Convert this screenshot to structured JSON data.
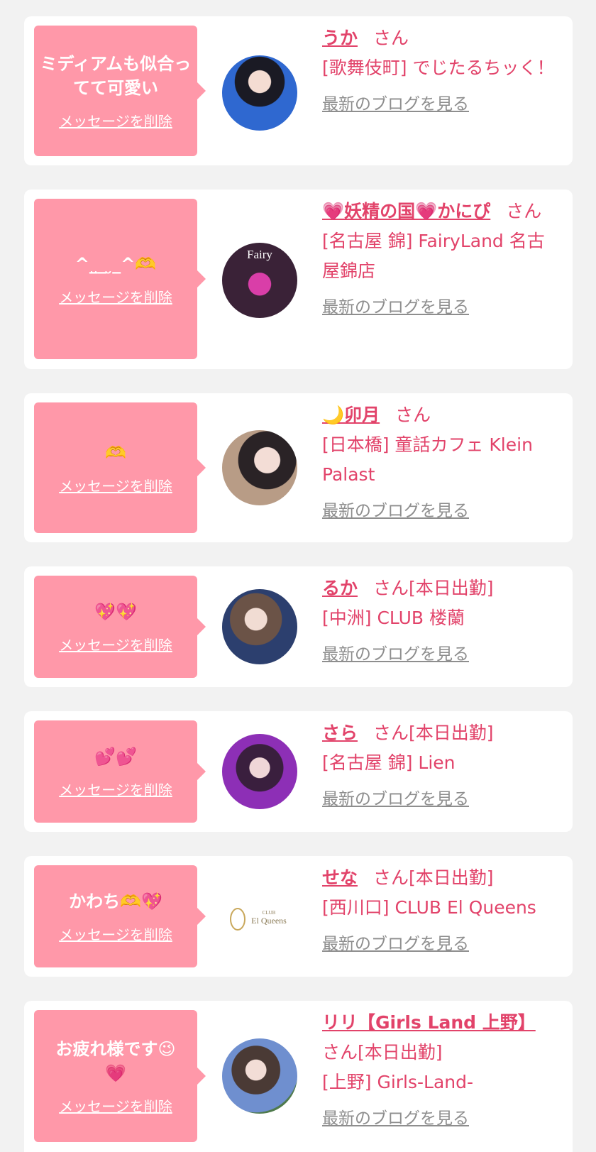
{
  "delete_label": "メッセージを削除",
  "blog_label": "最新のブログを見る",
  "colors": {
    "bubble": "#ff98a9",
    "accent": "#e2436a",
    "link_gray": "#8e8e8e",
    "background": "#f2f2f2"
  },
  "cards": [
    {
      "message": "ミディアムも似合ってて可愛い",
      "name": "うか",
      "suffix": "さん",
      "shop": "[歌舞伎町] でじたるちッく！"
    },
    {
      "message": "^_̮_ ̮_^🫶",
      "name": "💗妖精の国💗かにぴ",
      "suffix": "さん",
      "shop": "[名古屋 錦] FairyLand 名古屋錦店"
    },
    {
      "message": "🫶",
      "name": "🌙卯月",
      "suffix": "さん",
      "shop": "[日本橋] 童話カフェ Klein Palast"
    },
    {
      "message": "💖💖",
      "name": "るか",
      "suffix": "さん[本日出勤]",
      "shop": "[中洲] CLUB 楼蘭"
    },
    {
      "message": "💕💕",
      "name": "さら",
      "suffix": "さん[本日出勤]",
      "shop": "[名古屋 錦] Lien"
    },
    {
      "message": "かわち🫶💖",
      "name": "せな",
      "suffix": "さん[本日出勤]",
      "shop": "[西川口] CLUB El Queens"
    },
    {
      "message": "お疲れ様です😉💗",
      "name": "リリ【Girls Land 上野】",
      "suffix": "さん[本日出勤]",
      "shop": "[上野] Girls-Land-"
    }
  ],
  "logo_texts": {
    "club": "CLUB",
    "el_queens": "El Queens",
    "fairy": "Fairy"
  }
}
